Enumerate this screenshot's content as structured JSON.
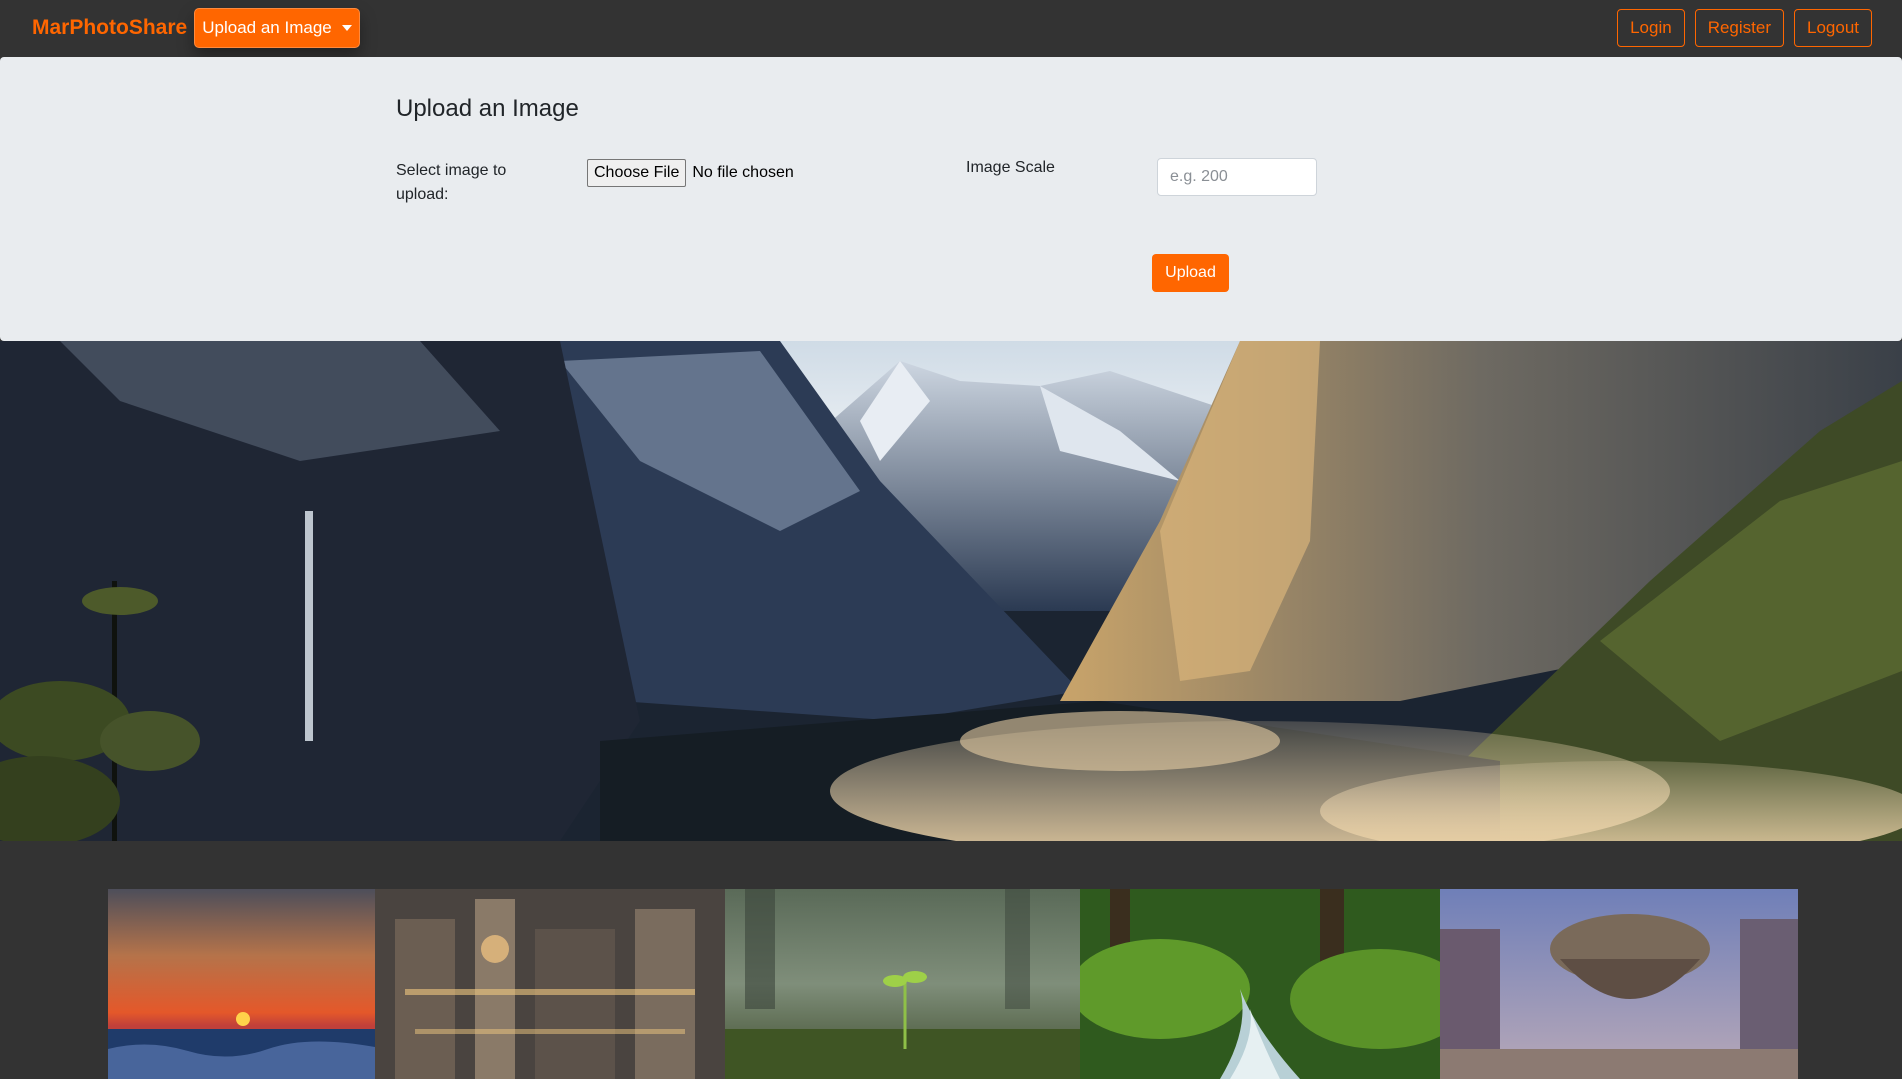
{
  "navbar": {
    "brand": "MarPhotoShare",
    "upload_dropdown_label": "Upload an Image",
    "buttons": {
      "login": "Login",
      "register": "Register",
      "logout": "Logout"
    }
  },
  "upload_form": {
    "title": "Upload an Image",
    "select_label": "Select image to upload:",
    "choose_file_label": "Choose File",
    "file_status": "No file chosen",
    "scale_label": "Image Scale",
    "scale_placeholder": "e.g. 200",
    "submit_label": "Upload"
  },
  "hero": {
    "description": "mountain-valley-landscape"
  },
  "gallery": {
    "thumbnails": [
      {
        "name": "sunset-ocean-thumb"
      },
      {
        "name": "steampunk-city-thumb"
      },
      {
        "name": "sprout-forest-thumb"
      },
      {
        "name": "forest-stream-thumb"
      },
      {
        "name": "airship-fantasy-thumb"
      }
    ]
  },
  "colors": {
    "accent": "#ff6600",
    "navbar_bg": "#333333",
    "panel_bg": "#e9ecef"
  }
}
